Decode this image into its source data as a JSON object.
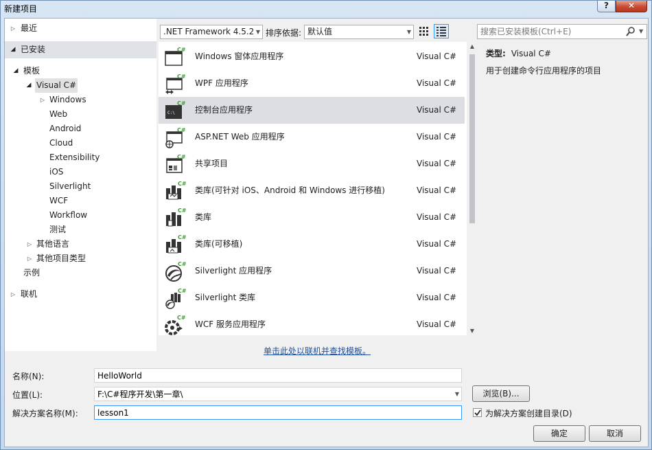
{
  "window": {
    "title": "新建项目",
    "help_glyph": "?",
    "close_glyph": "✕"
  },
  "tree": {
    "recent": "最近",
    "installed": "已安装",
    "templates": "模板",
    "visual_csharp": "Visual C#",
    "children": [
      "Windows",
      "Web",
      "Android",
      "Cloud",
      "Extensibility",
      "iOS",
      "Silverlight",
      "WCF",
      "Workflow",
      "测试"
    ],
    "other_languages": "其他语言",
    "other_project_types": "其他项目类型",
    "samples": "示例",
    "online": "联机"
  },
  "toolbar": {
    "framework": ".NET Framework 4.5.2",
    "sort_label": "排序依据:",
    "sort_value": "默认值",
    "search_placeholder": "搜索已安装模板(Ctrl+E)"
  },
  "templates": [
    {
      "name": "Windows 窗体应用程序",
      "lang": "Visual C#",
      "icon": "winforms-icon"
    },
    {
      "name": "WPF 应用程序",
      "lang": "Visual C#",
      "icon": "wpf-icon"
    },
    {
      "name": "控制台应用程序",
      "lang": "Visual C#",
      "icon": "console-icon"
    },
    {
      "name": "ASP.NET Web 应用程序",
      "lang": "Visual C#",
      "icon": "web-app-icon"
    },
    {
      "name": "共享项目",
      "lang": "Visual C#",
      "icon": "shared-project-icon"
    },
    {
      "name": "类库(可针对 iOS、Android 和 Windows 进行移植)",
      "lang": "Visual C#",
      "icon": "portable-library-icon"
    },
    {
      "name": "类库",
      "lang": "Visual C#",
      "icon": "class-library-icon"
    },
    {
      "name": "类库(可移植)",
      "lang": "Visual C#",
      "icon": "portable-class-library-icon"
    },
    {
      "name": "Silverlight 应用程序",
      "lang": "Visual C#",
      "icon": "silverlight-app-icon"
    },
    {
      "name": "Silverlight 类库",
      "lang": "Visual C#",
      "icon": "silverlight-library-icon"
    },
    {
      "name": "WCF 服务应用程序",
      "lang": "Visual C#",
      "icon": "wcf-service-icon"
    }
  ],
  "details": {
    "type_label": "类型:",
    "type_value": "Visual C#",
    "description": "用于创建命令行应用程序的项目"
  },
  "online_link": "单击此处以联机并查找模板。",
  "form": {
    "name_label": "名称(N):",
    "name_value": "HelloWorld",
    "location_label": "位置(L):",
    "location_value": "F:\\C#程序开发\\第一章\\",
    "browse_label": "浏览(B)...",
    "solution_label": "解决方案名称(M):",
    "solution_value": "lesson1",
    "create_dir_label": "为解决方案创建目录(D)",
    "ok_label": "确定",
    "cancel_label": "取消"
  },
  "colors": {
    "accent": "#3399ff",
    "csharp_green": "#3f9c35",
    "link": "#1e50a2",
    "selection": "#dcdee3"
  }
}
